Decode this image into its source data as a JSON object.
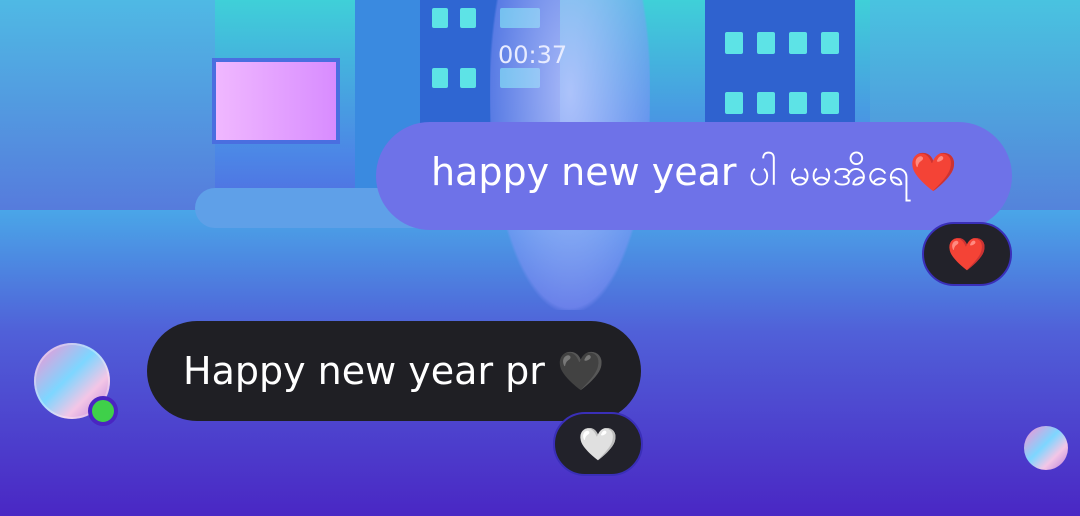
{
  "chat": {
    "timestamp": "00:37",
    "outgoing": {
      "text": "happy new year ပါ မမအိရေ❤️",
      "reaction": "❤️"
    },
    "incoming": {
      "text": "Happy new year pr 🖤",
      "reaction": "🤍"
    }
  },
  "colors": {
    "outgoing_bubble": "#6e72e8",
    "incoming_bubble": "#1f1f24",
    "online_status": "#3fd04a"
  },
  "icons": {
    "sender_avatar": "profile-avatar",
    "read_receipt": "read-receipt-avatar"
  }
}
